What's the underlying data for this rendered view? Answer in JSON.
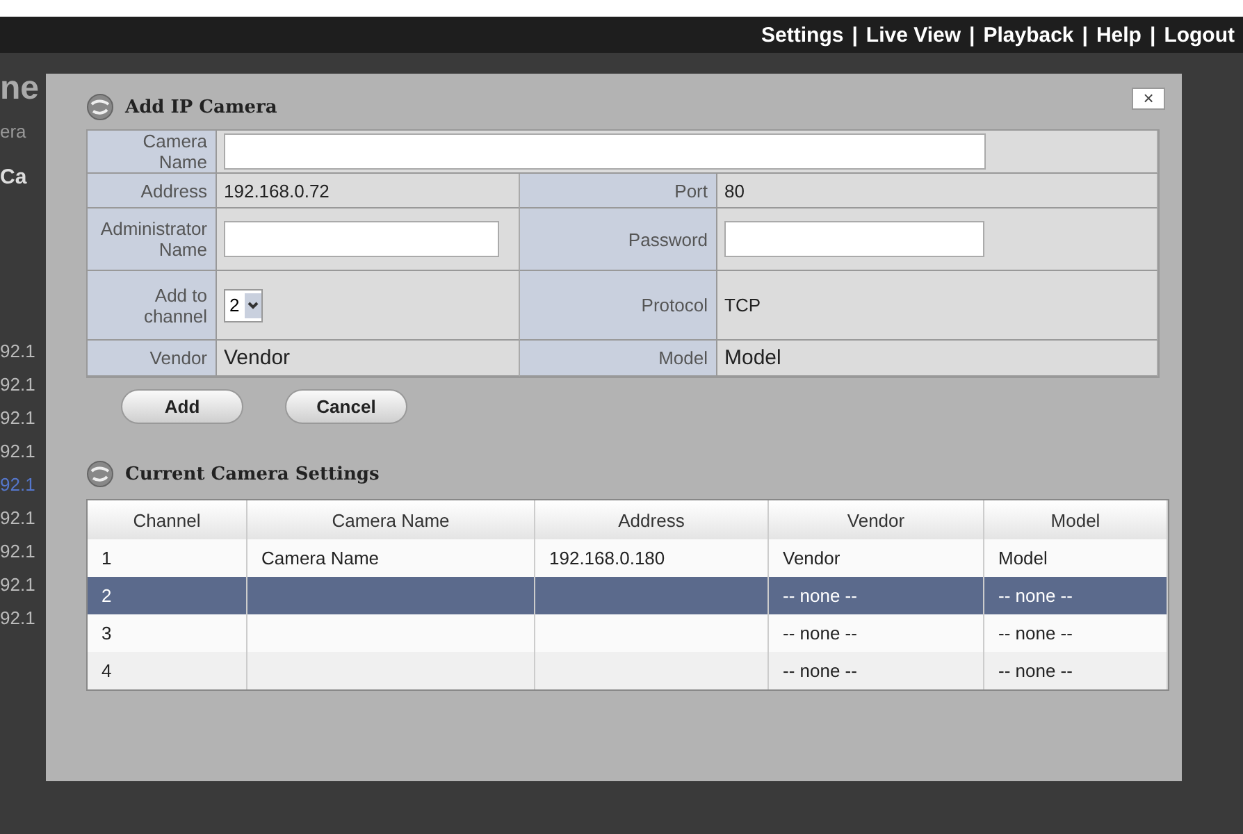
{
  "nav": [
    "Settings",
    "Live View",
    "Playback",
    "Help",
    "Logout"
  ],
  "nav_separator": "|",
  "background": {
    "heading": "ne",
    "tab": "era",
    "section": "Ca",
    "rows": [
      {
        "text": "92.1",
        "link": false
      },
      {
        "text": "92.1",
        "link": false
      },
      {
        "text": "92.1",
        "link": false
      },
      {
        "text": "92.1",
        "link": false
      },
      {
        "text": "92.1",
        "link": true
      },
      {
        "text": "92.1",
        "link": false
      },
      {
        "text": "92.1",
        "link": false
      },
      {
        "text": "92.1",
        "link": false
      },
      {
        "text": "92.1",
        "link": false
      }
    ]
  },
  "dialog": {
    "title": "Add IP Camera",
    "close": "×",
    "form": {
      "camera_name": {
        "label": "Camera Name"
      },
      "address": {
        "label": "Address",
        "value": "192.168.0.72"
      },
      "port": {
        "label": "Port",
        "value": "80"
      },
      "admin_name": {
        "label": "Administrator Name"
      },
      "password": {
        "label": "Password"
      },
      "channel": {
        "label": "Add to channel",
        "value": "2"
      },
      "protocol": {
        "label": "Protocol",
        "value": "TCP"
      },
      "vendor": {
        "label": "Vendor",
        "value": "Vendor"
      },
      "model": {
        "label": "Model",
        "value": "Model"
      }
    },
    "buttons": [
      "Add",
      "Cancel"
    ],
    "settings_title": "Current Camera Settings",
    "table": {
      "columns": [
        "Channel",
        "Camera Name",
        "Address",
        "Vendor",
        "Model"
      ],
      "rows": [
        {
          "cells": [
            "1",
            "Camera Name",
            "192.168.0.180",
            "Vendor",
            "Model"
          ],
          "selected": false
        },
        {
          "cells": [
            "2",
            "",
            "",
            "-- none --",
            "-- none --"
          ],
          "selected": true
        },
        {
          "cells": [
            "3",
            "",
            "",
            "-- none --",
            "-- none --"
          ],
          "selected": false
        },
        {
          "cells": [
            "4",
            "",
            "",
            "-- none --",
            "-- none --"
          ],
          "selected": false
        }
      ]
    }
  }
}
